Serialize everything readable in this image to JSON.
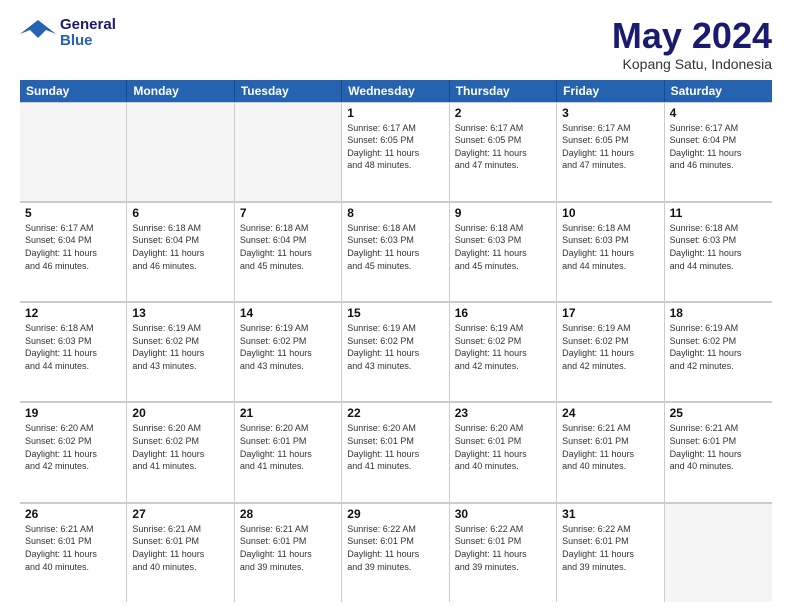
{
  "header": {
    "logo_general": "General",
    "logo_blue": "Blue",
    "month_title": "May 2024",
    "location": "Kopang Satu, Indonesia"
  },
  "days_of_week": [
    "Sunday",
    "Monday",
    "Tuesday",
    "Wednesday",
    "Thursday",
    "Friday",
    "Saturday"
  ],
  "weeks": [
    [
      {
        "day": "",
        "info": "",
        "empty": true
      },
      {
        "day": "",
        "info": "",
        "empty": true
      },
      {
        "day": "",
        "info": "",
        "empty": true
      },
      {
        "day": "1",
        "info": "Sunrise: 6:17 AM\nSunset: 6:05 PM\nDaylight: 11 hours\nand 48 minutes.",
        "empty": false
      },
      {
        "day": "2",
        "info": "Sunrise: 6:17 AM\nSunset: 6:05 PM\nDaylight: 11 hours\nand 47 minutes.",
        "empty": false
      },
      {
        "day": "3",
        "info": "Sunrise: 6:17 AM\nSunset: 6:05 PM\nDaylight: 11 hours\nand 47 minutes.",
        "empty": false
      },
      {
        "day": "4",
        "info": "Sunrise: 6:17 AM\nSunset: 6:04 PM\nDaylight: 11 hours\nand 46 minutes.",
        "empty": false
      }
    ],
    [
      {
        "day": "5",
        "info": "Sunrise: 6:17 AM\nSunset: 6:04 PM\nDaylight: 11 hours\nand 46 minutes.",
        "empty": false
      },
      {
        "day": "6",
        "info": "Sunrise: 6:18 AM\nSunset: 6:04 PM\nDaylight: 11 hours\nand 46 minutes.",
        "empty": false
      },
      {
        "day": "7",
        "info": "Sunrise: 6:18 AM\nSunset: 6:04 PM\nDaylight: 11 hours\nand 45 minutes.",
        "empty": false
      },
      {
        "day": "8",
        "info": "Sunrise: 6:18 AM\nSunset: 6:03 PM\nDaylight: 11 hours\nand 45 minutes.",
        "empty": false
      },
      {
        "day": "9",
        "info": "Sunrise: 6:18 AM\nSunset: 6:03 PM\nDaylight: 11 hours\nand 45 minutes.",
        "empty": false
      },
      {
        "day": "10",
        "info": "Sunrise: 6:18 AM\nSunset: 6:03 PM\nDaylight: 11 hours\nand 44 minutes.",
        "empty": false
      },
      {
        "day": "11",
        "info": "Sunrise: 6:18 AM\nSunset: 6:03 PM\nDaylight: 11 hours\nand 44 minutes.",
        "empty": false
      }
    ],
    [
      {
        "day": "12",
        "info": "Sunrise: 6:18 AM\nSunset: 6:03 PM\nDaylight: 11 hours\nand 44 minutes.",
        "empty": false
      },
      {
        "day": "13",
        "info": "Sunrise: 6:19 AM\nSunset: 6:02 PM\nDaylight: 11 hours\nand 43 minutes.",
        "empty": false
      },
      {
        "day": "14",
        "info": "Sunrise: 6:19 AM\nSunset: 6:02 PM\nDaylight: 11 hours\nand 43 minutes.",
        "empty": false
      },
      {
        "day": "15",
        "info": "Sunrise: 6:19 AM\nSunset: 6:02 PM\nDaylight: 11 hours\nand 43 minutes.",
        "empty": false
      },
      {
        "day": "16",
        "info": "Sunrise: 6:19 AM\nSunset: 6:02 PM\nDaylight: 11 hours\nand 42 minutes.",
        "empty": false
      },
      {
        "day": "17",
        "info": "Sunrise: 6:19 AM\nSunset: 6:02 PM\nDaylight: 11 hours\nand 42 minutes.",
        "empty": false
      },
      {
        "day": "18",
        "info": "Sunrise: 6:19 AM\nSunset: 6:02 PM\nDaylight: 11 hours\nand 42 minutes.",
        "empty": false
      }
    ],
    [
      {
        "day": "19",
        "info": "Sunrise: 6:20 AM\nSunset: 6:02 PM\nDaylight: 11 hours\nand 42 minutes.",
        "empty": false
      },
      {
        "day": "20",
        "info": "Sunrise: 6:20 AM\nSunset: 6:02 PM\nDaylight: 11 hours\nand 41 minutes.",
        "empty": false
      },
      {
        "day": "21",
        "info": "Sunrise: 6:20 AM\nSunset: 6:01 PM\nDaylight: 11 hours\nand 41 minutes.",
        "empty": false
      },
      {
        "day": "22",
        "info": "Sunrise: 6:20 AM\nSunset: 6:01 PM\nDaylight: 11 hours\nand 41 minutes.",
        "empty": false
      },
      {
        "day": "23",
        "info": "Sunrise: 6:20 AM\nSunset: 6:01 PM\nDaylight: 11 hours\nand 40 minutes.",
        "empty": false
      },
      {
        "day": "24",
        "info": "Sunrise: 6:21 AM\nSunset: 6:01 PM\nDaylight: 11 hours\nand 40 minutes.",
        "empty": false
      },
      {
        "day": "25",
        "info": "Sunrise: 6:21 AM\nSunset: 6:01 PM\nDaylight: 11 hours\nand 40 minutes.",
        "empty": false
      }
    ],
    [
      {
        "day": "26",
        "info": "Sunrise: 6:21 AM\nSunset: 6:01 PM\nDaylight: 11 hours\nand 40 minutes.",
        "empty": false
      },
      {
        "day": "27",
        "info": "Sunrise: 6:21 AM\nSunset: 6:01 PM\nDaylight: 11 hours\nand 40 minutes.",
        "empty": false
      },
      {
        "day": "28",
        "info": "Sunrise: 6:21 AM\nSunset: 6:01 PM\nDaylight: 11 hours\nand 39 minutes.",
        "empty": false
      },
      {
        "day": "29",
        "info": "Sunrise: 6:22 AM\nSunset: 6:01 PM\nDaylight: 11 hours\nand 39 minutes.",
        "empty": false
      },
      {
        "day": "30",
        "info": "Sunrise: 6:22 AM\nSunset: 6:01 PM\nDaylight: 11 hours\nand 39 minutes.",
        "empty": false
      },
      {
        "day": "31",
        "info": "Sunrise: 6:22 AM\nSunset: 6:01 PM\nDaylight: 11 hours\nand 39 minutes.",
        "empty": false
      },
      {
        "day": "",
        "info": "",
        "empty": true
      }
    ]
  ]
}
